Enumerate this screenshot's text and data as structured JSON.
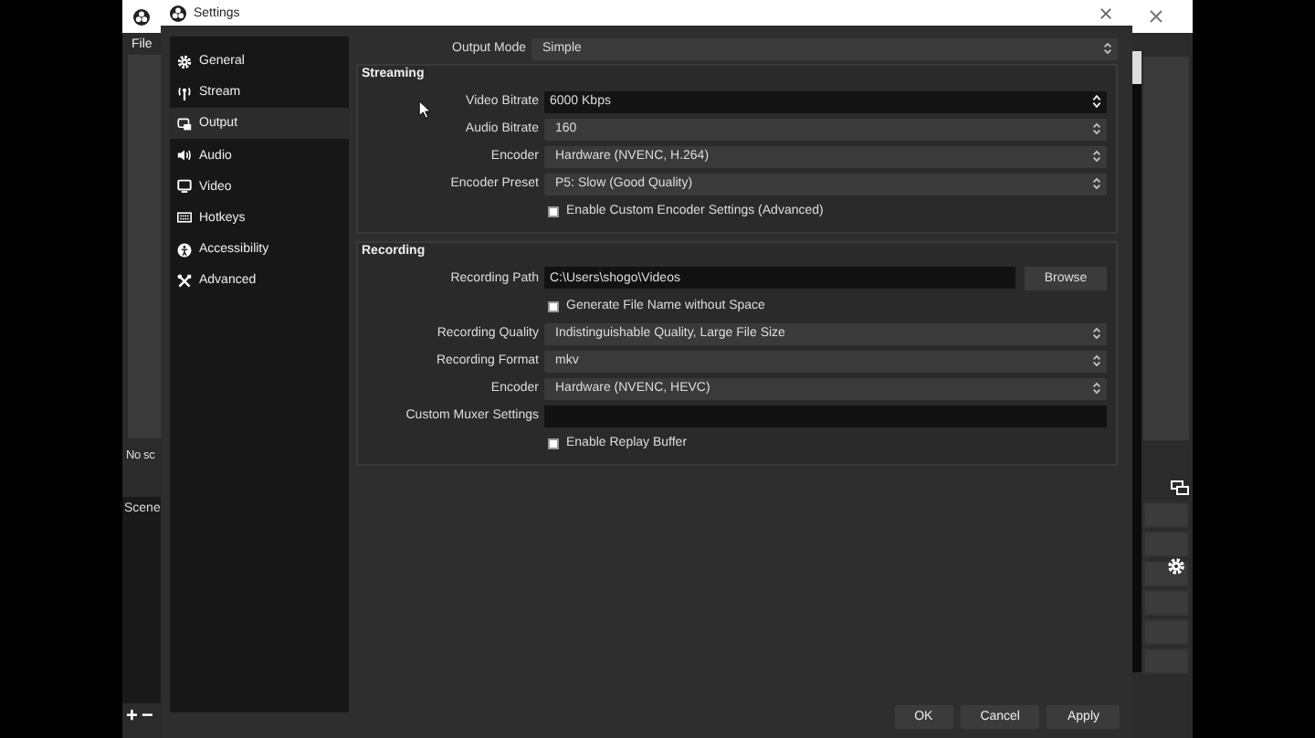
{
  "main_window": {
    "menu": [
      "File"
    ],
    "preview_message": "No sc",
    "scenes_title": "Scene",
    "scene_buttons": [
      "+",
      "−"
    ]
  },
  "settings": {
    "title": "Settings",
    "sidebar": [
      {
        "label": "General",
        "selected": false
      },
      {
        "label": "Stream",
        "selected": false
      },
      {
        "label": "Output",
        "selected": true
      },
      {
        "label": "Audio",
        "selected": false
      },
      {
        "label": "Video",
        "selected": false
      },
      {
        "label": "Hotkeys",
        "selected": false
      },
      {
        "label": "Accessibility",
        "selected": false
      },
      {
        "label": "Advanced",
        "selected": false
      }
    ],
    "output_mode": {
      "label": "Output Mode",
      "value": "Simple"
    },
    "groups": [
      {
        "title": "Streaming",
        "rows": [
          {
            "kind": "spin",
            "label": "Video Bitrate",
            "value": "6000 Kbps"
          },
          {
            "kind": "select",
            "label": "Audio Bitrate",
            "value": "160"
          },
          {
            "kind": "select",
            "label": "Encoder",
            "value": "Hardware (NVENC, H.264)"
          },
          {
            "kind": "select",
            "label": "Encoder Preset",
            "value": "P5: Slow (Good Quality)"
          },
          {
            "kind": "checkbox",
            "label": "Enable Custom Encoder Settings (Advanced)",
            "checked": false
          }
        ]
      },
      {
        "title": "Recording",
        "rows": [
          {
            "kind": "path",
            "label": "Recording Path",
            "value": "C:\\Users\\shogo\\Videos",
            "button": "Browse"
          },
          {
            "kind": "checkbox",
            "label": "Generate File Name without Space",
            "checked": false
          },
          {
            "kind": "select",
            "label": "Recording Quality",
            "value": "Indistinguishable Quality, Large File Size"
          },
          {
            "kind": "select",
            "label": "Recording Format",
            "value": "mkv"
          },
          {
            "kind": "select",
            "label": "Encoder",
            "value": "Hardware (NVENC, HEVC)"
          },
          {
            "kind": "text",
            "label": "Custom Muxer Settings"
          },
          {
            "kind": "checkbox",
            "label": "Enable Replay Buffer",
            "checked": false
          }
        ]
      }
    ],
    "buttons": [
      "OK",
      "Cancel",
      "Apply"
    ]
  }
}
